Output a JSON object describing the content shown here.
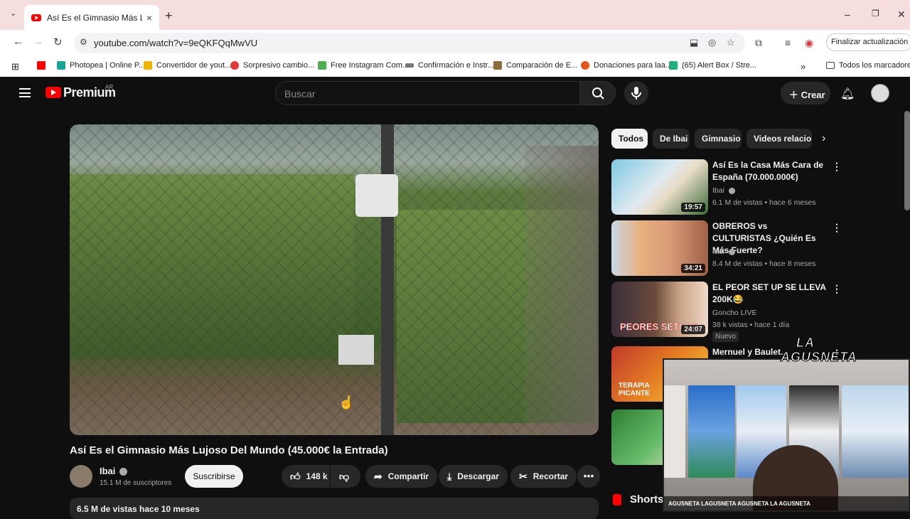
{
  "browser": {
    "tab_title": "Así Es el Gimnasio Más Lujoso D",
    "url": "youtube.com/watch?v=9eQKFQqMwVU",
    "update_label": "Finalizar actualización",
    "bookmarks": [
      {
        "label": "",
        "color": "#ff0000"
      },
      {
        "label": "Photopea | Online P...",
        "color": "#18a497"
      },
      {
        "label": "Convertidor de yout...",
        "color": "#f0b400"
      },
      {
        "label": "Sorpresivo cambio...",
        "color": "#e53935"
      },
      {
        "label": "Free Instagram Com...",
        "color": "#4caf50"
      },
      {
        "label": "Confirmación e Instr...",
        "color": "#555555"
      },
      {
        "label": "Comparación de E...",
        "color": "#8d6e3a"
      },
      {
        "label": "Donaciones para laa...",
        "color": "#e8541c"
      },
      {
        "label": "(65) Alert Box / Stre...",
        "color": "#1fb17a"
      }
    ],
    "all_bookmarks_label": "Todos los marcadores"
  },
  "header": {
    "logo_text": "Premium",
    "region": "AR",
    "search_placeholder": "Buscar",
    "create_label": "Crear"
  },
  "video": {
    "title": "Así Es el Gimnasio Más Lujoso Del Mundo (45.000€ la Entrada)",
    "channel": "Ibai",
    "subscribers": "15.1 M de suscriptores",
    "subscribe_label": "Suscribirse",
    "likes": "148 k",
    "share_label": "Compartir",
    "download_label": "Descargar",
    "clip_label": "Recortar",
    "views_line": "6.5 M de vistas  hace 10 meses"
  },
  "chips": [
    "Todos",
    "De Ibai",
    "Gimnasio",
    "Videos relacionados"
  ],
  "recommendations": [
    {
      "title": "Así Es la Casa Más Cara de España (70.000.000€)",
      "channel": "Ibai",
      "meta": "6.1 M de vistas • hace 6 meses",
      "duration": "19:57",
      "verified": true,
      "badge": ""
    },
    {
      "title": "OBREROS vs CULTURISTAS ¿Quién Es Más Fuerte?",
      "channel": "Ibai",
      "meta": "8.4 M de vistas • hace 8 meses",
      "duration": "34:21",
      "verified": true,
      "badge": ""
    },
    {
      "title": "EL PEOR SET UP SE LLEVA 200K😂",
      "channel": "Goncho LIVE",
      "meta": "38 k vistas • hace 1 día",
      "duration": "24:07",
      "verified": false,
      "badge": "Nuevo",
      "thumb_text": "PEORES SETUPS"
    },
    {
      "title": "Mernuel y Baulet...",
      "channel": "",
      "meta": "",
      "duration": "",
      "verified": false,
      "badge": "",
      "thumb_text": "TERAPIA PICANTE"
    }
  ],
  "shorts_label": "Shorts",
  "webcam": {
    "watermark": "LA AGUSNETA",
    "socials": "AGUSNETA   LAGUSNETA   AGUSNETA   LA AGUSNETA"
  }
}
